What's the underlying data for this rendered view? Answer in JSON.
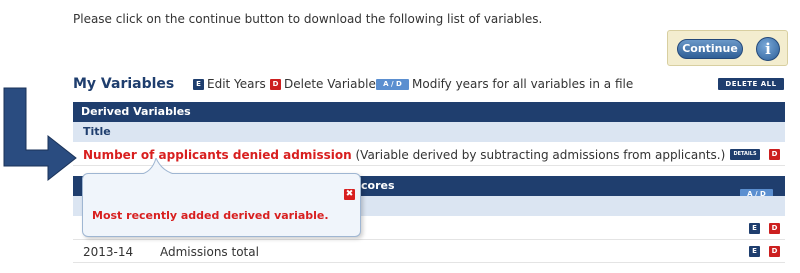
{
  "instruction": "Please click on the continue button to download the following list of variables.",
  "continue_panel": {
    "continue_label": "Continue",
    "info_label": "i"
  },
  "my_variables": {
    "title": "My Variables",
    "legend": {
      "edit_badge": "E",
      "edit_label": "Edit Years",
      "delete_badge": "D",
      "delete_label": "Delete Variable",
      "ad_badge": "A / D",
      "ad_label": "Modify years for all variables in a file"
    },
    "delete_all_label": "DELETE ALL"
  },
  "derived_section": {
    "header": "Derived Variables",
    "column_title": "Title",
    "row": {
      "name": "Number of applicants denied admission",
      "description": "(Variable derived by subtracting admissions from applicants.)",
      "details_badge": "DETAILS",
      "delete_badge": "D"
    }
  },
  "second_section": {
    "header_visible_fragment": "cores",
    "ad_badge": "A / D",
    "rows": [
      {
        "year": "",
        "label": "",
        "edit_badge": "E",
        "delete_badge": "D"
      },
      {
        "year": "2013-14",
        "label": "Admissions total",
        "edit_badge": "E",
        "delete_badge": "D"
      }
    ]
  },
  "callout": {
    "text": "Most recently added derived variable.",
    "close_icon": "✖"
  },
  "colors": {
    "navy": "#1f3e6e",
    "red": "#d81f1f",
    "light_blue": "#dbe5f2"
  }
}
